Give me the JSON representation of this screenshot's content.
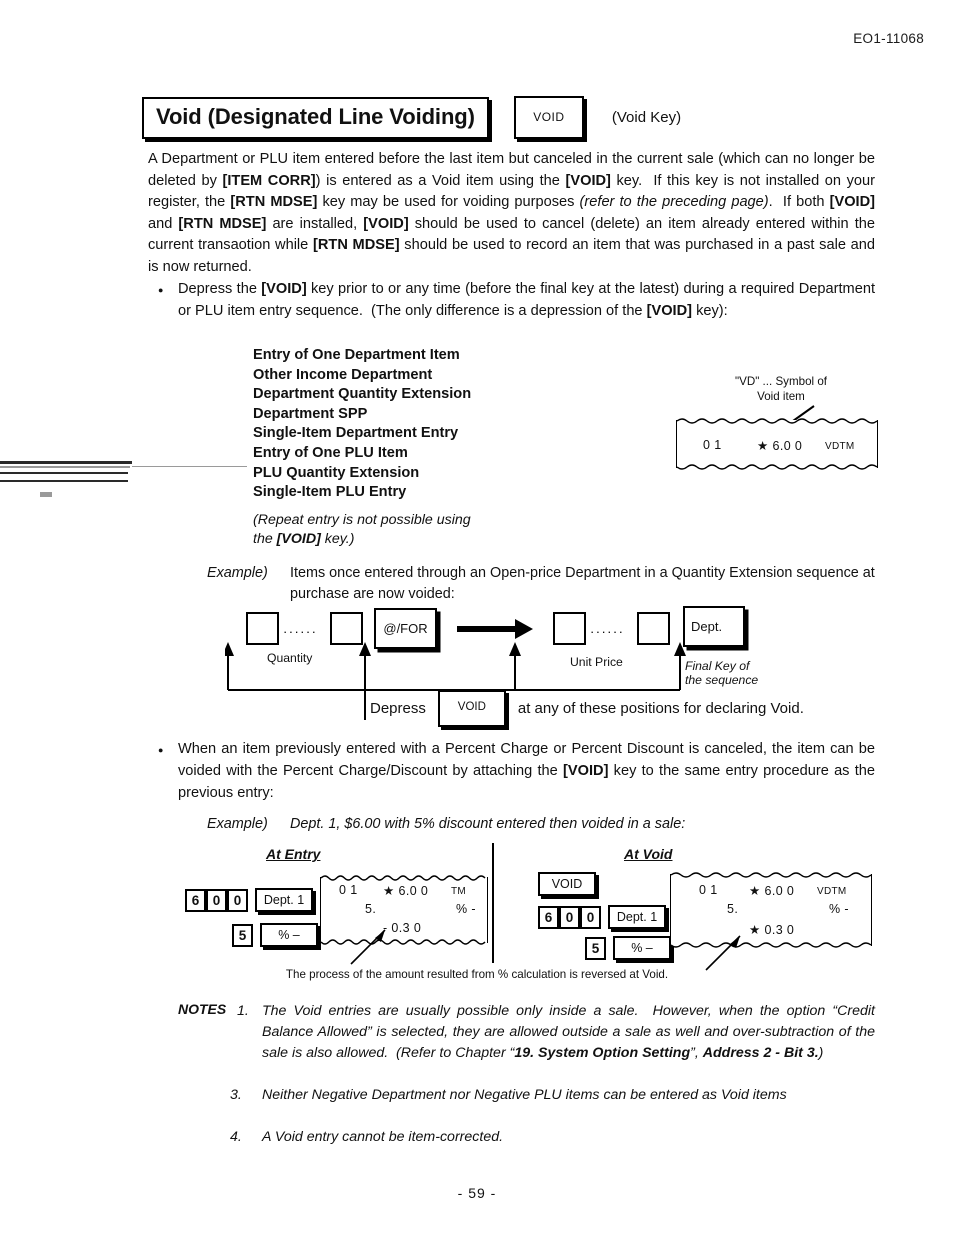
{
  "header": {
    "doc_code": "EO1-11068"
  },
  "title": {
    "heading": "Void (Designated Line Voiding)",
    "key_label": "VOID",
    "key_note": "(Void Key)"
  },
  "intro": "A Department or PLU item entered before the last item but canceled in the current sale (which can no longer be deleted by [ITEM CORR]) is entered as a Void item using the [VOID] key.  If this key is not installed on your register, the [RTN MDSE] key may be used for voiding purposes (refer to the preceding page).  If both [VOID] and [RTN MDSE] are installed, [VOID] should be used to cancel (delete) an item already entered within the current transaotion while [RTN MDSE] should be used to record an item that was purchased in a past sale and is now returned.",
  "bullet1": "Depress the [VOID] key prior to or any time (before the final key at the latest) during a required Department or PLU item entry sequence.  (The only difference is a depression of the [VOID] key):",
  "bullet2": "When an item previously entered with a Percent Charge or Percent Discount is canceled, the item can be voided with the Percent Charge/Discount by attaching the [VOID] key to the same entry procedure as the previous entry:",
  "entry_list": [
    "Entry of One Department Item",
    "Other Income Department",
    "Department Quantity Extension",
    "Department SPP",
    "Single-Item Department Entry",
    "Entry of One PLU Item",
    "PLU Quantity Extension",
    "Single-Item PLU Entry"
  ],
  "repeat_note_line1": "(Repeat entry is not possible using",
  "repeat_note_line2": "the [VOID] key.)",
  "vd_callout": {
    "line1": "\"VD\" ... Symbol of",
    "line2": "Void item"
  },
  "receipt_top": {
    "col1": "0 1",
    "col2": "★ 6.0 0",
    "col3": "VDTM"
  },
  "example1": {
    "label": "Example)",
    "text": "Items once entered through an Open-price Department in a Quantity Extension sequence at purchase are now voided:"
  },
  "sequence": {
    "quantity_caption": "Quantity",
    "unit_price_caption": "Unit Price",
    "atfor_key": "@/FOR",
    "dept_key": "Dept.",
    "final_key_line1": "Final Key of",
    "final_key_line2": "the sequence",
    "depress_label": "Depress",
    "void_key": "VOID",
    "depress_tail": "at any of these positions for declaring Void.",
    "dots": "······"
  },
  "example2": {
    "label": "Example)",
    "text": "Dept. 1, $6.00 with 5% discount entered then voided in a sale:"
  },
  "at_entry": {
    "heading": "At Entry",
    "keys_row1": [
      "6",
      "0",
      "0"
    ],
    "dept_key": "Dept. 1",
    "keys_row2": [
      "5"
    ],
    "percent_key": "% –",
    "receipt": {
      "line1_col1": "0 1",
      "line1_col2": "★ 6.0 0",
      "line1_col3": "TM",
      "line2_col1": "5.",
      "line2_col2": "% -",
      "line3": "- 0.3 0"
    }
  },
  "at_void": {
    "heading": "At Void",
    "void_key": "VOID",
    "keys_row1": [
      "6",
      "0",
      "0"
    ],
    "dept_key": "Dept. 1",
    "keys_row2": [
      "5"
    ],
    "percent_key": "% –",
    "receipt": {
      "line1_col1": "0 1",
      "line1_col2": "★ 6.0 0",
      "line1_col3": "VDTM",
      "line2_col1": "5.",
      "line2_col2": "% -",
      "line3": "★ 0.3 0"
    }
  },
  "footnote": "The process of the amount resulted from % calculation is reversed at Void.",
  "notes": {
    "label": "NOTES",
    "items": [
      {
        "num": "1.",
        "text": "The Void entries are usually possible only inside a sale.  However, when the option \"Credit Balance Allowed\" is selected, they are allowed outside a sale as well and over-subtraction of the sale is also allowed.  (Refer to Chapter \"19. System Option Setting\", Address 2 - Bit 3.)"
      },
      {
        "num": "3.",
        "text": "Neither Negative Department nor Negative PLU items can be entered as Void items"
      },
      {
        "num": "4.",
        "text": "A Void entry cannot be item-corrected."
      }
    ]
  },
  "page_number": "- 59 -"
}
